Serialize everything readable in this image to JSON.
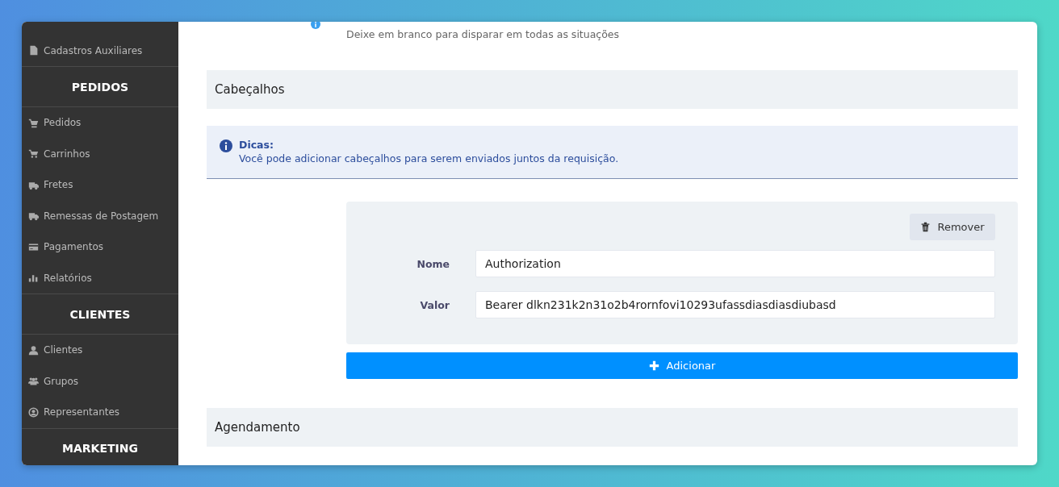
{
  "sidebar": {
    "items": [
      {
        "kind": "link",
        "label": "Cadastros Auxiliares"
      },
      {
        "kind": "section",
        "label": "PEDIDOS"
      },
      {
        "kind": "link",
        "label": "Pedidos"
      },
      {
        "kind": "link",
        "label": "Carrinhos"
      },
      {
        "kind": "link",
        "label": "Fretes"
      },
      {
        "kind": "link",
        "label": "Remessas de Postagem"
      },
      {
        "kind": "link",
        "label": "Pagamentos"
      },
      {
        "kind": "link",
        "label": "Relatórios"
      },
      {
        "kind": "section",
        "label": "CLIENTES"
      },
      {
        "kind": "link",
        "label": "Clientes"
      },
      {
        "kind": "link",
        "label": "Grupos"
      },
      {
        "kind": "link",
        "label": "Representantes"
      },
      {
        "kind": "section",
        "label": "MARKETING"
      }
    ]
  },
  "trigger_field": {
    "help": "Deixe em branco para disparar em todas as situações"
  },
  "headers_section": {
    "title": "Cabeçalhos",
    "tip": {
      "title": "Dicas:",
      "text": "Você pode adicionar cabeçalhos para serem enviados juntos da requisição."
    },
    "headers": [
      {
        "remove_label": "Remover",
        "fields": [
          {
            "label": "Nome",
            "value": "Authorization"
          },
          {
            "label": "Valor",
            "value": "Bearer dlkn231k2n31o2b4rornfovi10293ufassdiasdiasdiubasd"
          }
        ]
      }
    ],
    "add_button": "Adicionar"
  },
  "scheduling_section": {
    "title": "Agendamento"
  }
}
